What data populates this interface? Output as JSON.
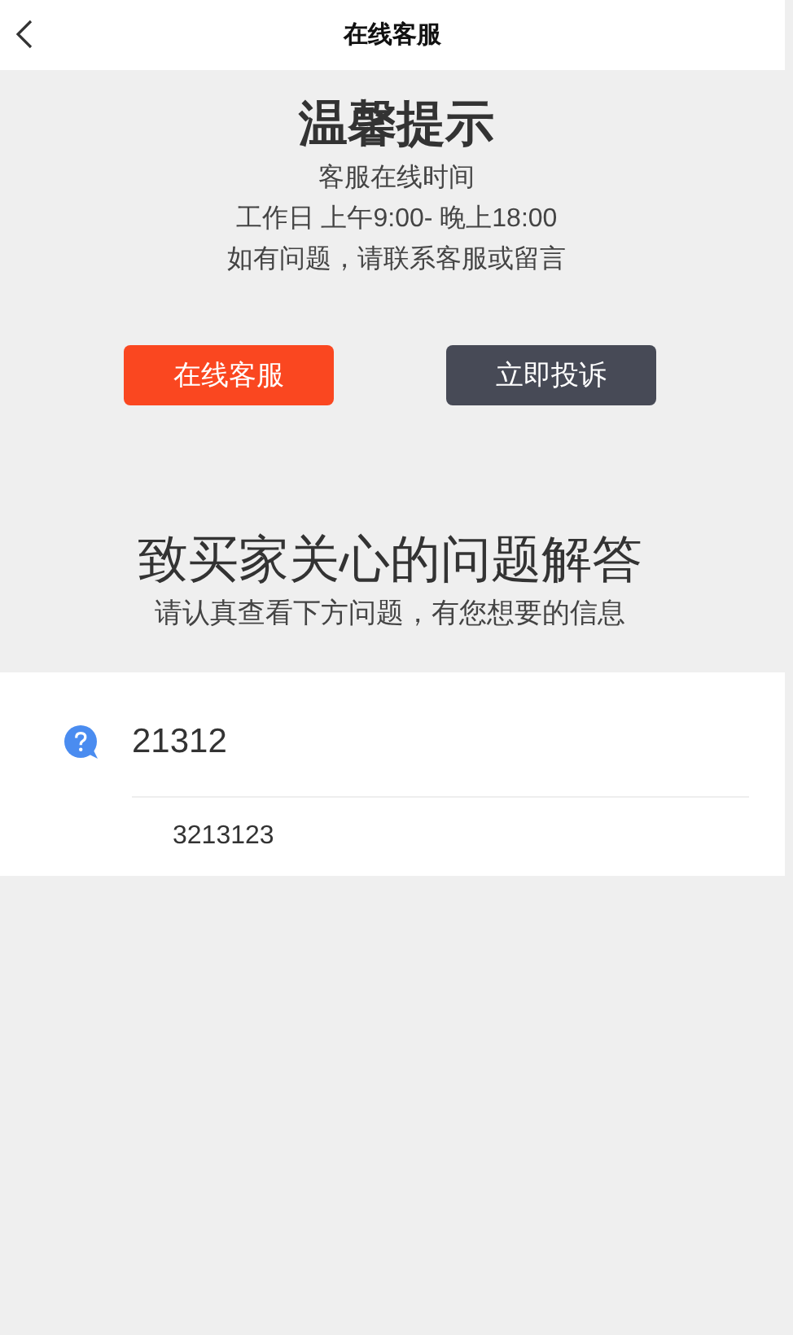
{
  "header": {
    "title": "在线客服"
  },
  "notice": {
    "title": "温馨提示",
    "lines": [
      "客服在线时间",
      "工作日 上午9:00- 晚上18:00",
      "如有问题，请联系客服或留言"
    ]
  },
  "buttons": [
    {
      "label": "在线客服",
      "kind": "primary"
    },
    {
      "label": "立即投诉",
      "kind": "secondary"
    }
  ],
  "faq": {
    "title": "致买家关心的问题解答",
    "subtitle": "请认真查看下方问题，有您想要的信息",
    "items": [
      {
        "question": "21312",
        "answer": "3213123"
      }
    ]
  }
}
